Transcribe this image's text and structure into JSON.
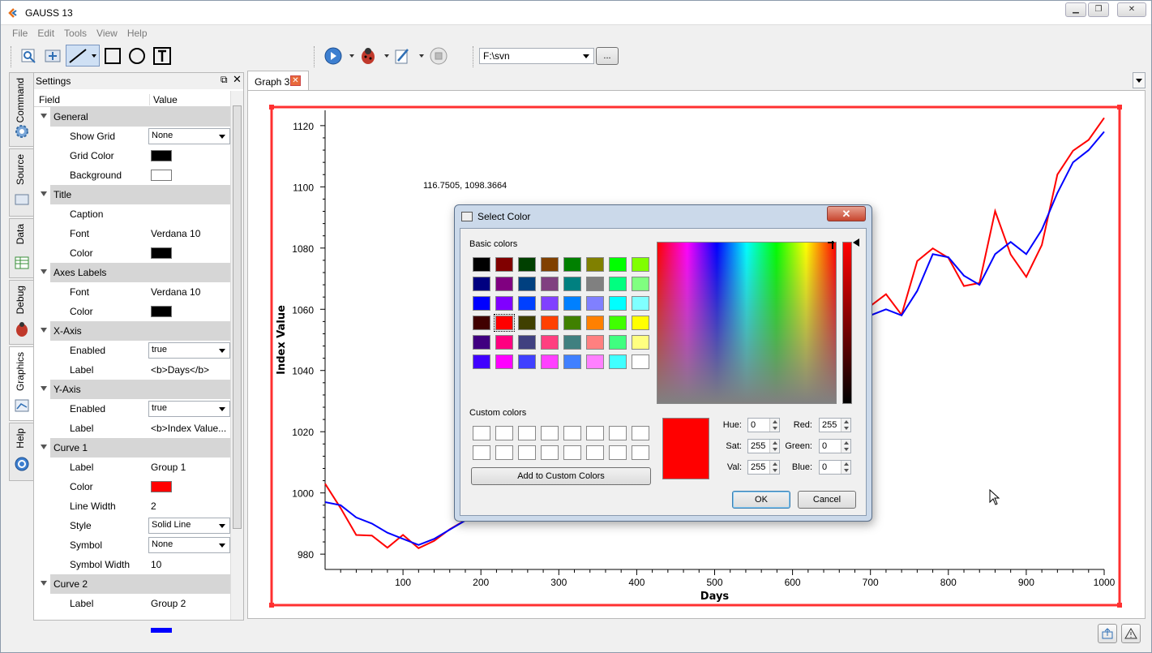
{
  "window": {
    "title": "GAUSS 13"
  },
  "menu": [
    "File",
    "Edit",
    "Tools",
    "View",
    "Help"
  ],
  "toolbar": {
    "path": "F:\\svn",
    "browse_label": "..."
  },
  "sidetabs": [
    "Command",
    "Source",
    "Data",
    "Debug",
    "Graphics",
    "Help"
  ],
  "settings": {
    "title": "Settings",
    "col_field": "Field",
    "col_value": "Value",
    "rows": [
      {
        "type": "section",
        "field": "General"
      },
      {
        "type": "dropdown",
        "field": "Show Grid",
        "value": "None"
      },
      {
        "type": "swatch",
        "field": "Grid Color",
        "color": "#000000"
      },
      {
        "type": "swatch",
        "field": "Background",
        "color": "#ffffff"
      },
      {
        "type": "section",
        "field": "Title"
      },
      {
        "type": "text",
        "field": "Caption",
        "value": ""
      },
      {
        "type": "text",
        "field": "Font",
        "value": "Verdana 10"
      },
      {
        "type": "swatch",
        "field": "Color",
        "color": "#000000"
      },
      {
        "type": "section",
        "field": "Axes Labels"
      },
      {
        "type": "text",
        "field": "Font",
        "value": "Verdana 10"
      },
      {
        "type": "swatch",
        "field": "Color",
        "color": "#000000"
      },
      {
        "type": "section",
        "field": "X-Axis"
      },
      {
        "type": "dropdown",
        "field": "Enabled",
        "value": "true"
      },
      {
        "type": "text",
        "field": "Label",
        "value": "<b>Days</b>"
      },
      {
        "type": "section",
        "field": "Y-Axis"
      },
      {
        "type": "dropdown",
        "field": "Enabled",
        "value": "true"
      },
      {
        "type": "text",
        "field": "Label",
        "value": "<b>Index Value..."
      },
      {
        "type": "section",
        "field": "Curve 1"
      },
      {
        "type": "text",
        "field": "Label",
        "value": "Group 1"
      },
      {
        "type": "swatch",
        "field": "Color",
        "color": "#ff0000"
      },
      {
        "type": "text",
        "field": "Line Width",
        "value": "2"
      },
      {
        "type": "dropdown",
        "field": "Style",
        "value": "Solid Line"
      },
      {
        "type": "dropdown",
        "field": "Symbol",
        "value": "None"
      },
      {
        "type": "text",
        "field": "Symbol Width",
        "value": "10"
      },
      {
        "type": "section",
        "field": "Curve 2"
      },
      {
        "type": "text",
        "field": "Label",
        "value": "Group 2"
      },
      {
        "type": "swatch",
        "field": "",
        "color": "#0000ff"
      }
    ]
  },
  "graph_tab": {
    "label": "Graph 3",
    "close_icon": "close-icon"
  },
  "chart_data": {
    "type": "line",
    "xlabel": "Days",
    "ylabel": "Index Value",
    "xlim": [
      0,
      1000
    ],
    "ylim": [
      975,
      1125
    ],
    "xticks": [
      100,
      200,
      300,
      400,
      500,
      600,
      700,
      800,
      900,
      1000
    ],
    "yticks": [
      980,
      1000,
      1020,
      1040,
      1060,
      1080,
      1100,
      1120
    ],
    "coord_readout": "116.7505, 1098.3664",
    "series": [
      {
        "color": "#ff0000",
        "x": [
          0,
          20,
          40,
          60,
          80,
          100,
          120,
          140,
          160,
          180,
          200,
          220,
          240,
          260,
          280,
          300,
          320,
          340,
          360,
          380,
          400,
          420,
          440,
          460,
          480,
          500,
          520,
          540,
          560,
          580,
          600,
          620,
          640,
          660,
          680,
          700,
          720,
          740,
          760,
          780,
          800,
          820,
          840,
          860,
          880,
          900,
          920,
          940,
          960,
          980,
          1000
        ],
        "y": [
          1001,
          993,
          990,
          985,
          985,
          982,
          982,
          985,
          989,
          994,
          998,
          1003,
          1008,
          1010,
          1004,
          990,
          1000,
          1010,
          1015,
          1020,
          1025,
          1030,
          1035,
          1040,
          1045,
          1050,
          1055,
          1060,
          1058,
          1062,
          1058,
          1054,
          1052,
          1054,
          1058,
          1062,
          1064,
          1058,
          1072,
          1084,
          1076,
          1070,
          1066,
          1090,
          1080,
          1070,
          1085,
          1100,
          1112,
          1114,
          1124
        ]
      },
      {
        "color": "#0000ff",
        "x": [
          0,
          20,
          40,
          60,
          80,
          100,
          120,
          140,
          160,
          180,
          200,
          220,
          240,
          260,
          280,
          300,
          320,
          340,
          360,
          380,
          400,
          420,
          440,
          460,
          480,
          500,
          520,
          540,
          560,
          580,
          600,
          620,
          640,
          660,
          680,
          700,
          720,
          740,
          760,
          780,
          800,
          820,
          840,
          860,
          880,
          900,
          920,
          940,
          960,
          980,
          1000
        ],
        "y": [
          997,
          996,
          992,
          990,
          987,
          985,
          983,
          985,
          988,
          991,
          994,
          998,
          1002,
          1004,
          1002,
          995,
          997,
          1004,
          1010,
          1015,
          1020,
          1025,
          1030,
          1035,
          1040,
          1045,
          1050,
          1054,
          1056,
          1058,
          1056,
          1054,
          1052,
          1053,
          1055,
          1058,
          1060,
          1058,
          1066,
          1078,
          1077,
          1071,
          1068,
          1078,
          1082,
          1078,
          1086,
          1098,
          1108,
          1112,
          1118
        ]
      }
    ]
  },
  "dialog": {
    "title": "Select Color",
    "basic_colors_label": "Basic colors",
    "custom_colors_label": "Custom colors",
    "add_custom_label": "Add to Custom Colors",
    "ok_label": "OK",
    "cancel_label": "Cancel",
    "basic_colors": [
      "#000000",
      "#800000",
      "#004000",
      "#804000",
      "#008000",
      "#808000",
      "#00ff00",
      "#80ff00",
      "#000080",
      "#800080",
      "#004080",
      "#804080",
      "#008080",
      "#808080",
      "#00ff80",
      "#80ff80",
      "#0000ff",
      "#8000ff",
      "#0040ff",
      "#8040ff",
      "#0080ff",
      "#8080ff",
      "#00ffff",
      "#80ffff",
      "#400000",
      "#ff0000",
      "#404000",
      "#ff4000",
      "#408000",
      "#ff8000",
      "#40ff00",
      "#ffff00",
      "#400080",
      "#ff0080",
      "#404080",
      "#ff4080",
      "#408080",
      "#ff8080",
      "#40ff80",
      "#ffff80",
      "#4000ff",
      "#ff00ff",
      "#4040ff",
      "#ff40ff",
      "#4080ff",
      "#ff80ff",
      "#40ffff",
      "#ffffff"
    ],
    "selected_color": "#ff0000",
    "hue_label": "Hue:",
    "hue": "0",
    "sat_label": "Sat:",
    "sat": "255",
    "val_label": "Val:",
    "val": "255",
    "red_label": "Red:",
    "red": "255",
    "green_label": "Green:",
    "green": "0",
    "blue_label": "Blue:",
    "blue": "0"
  }
}
